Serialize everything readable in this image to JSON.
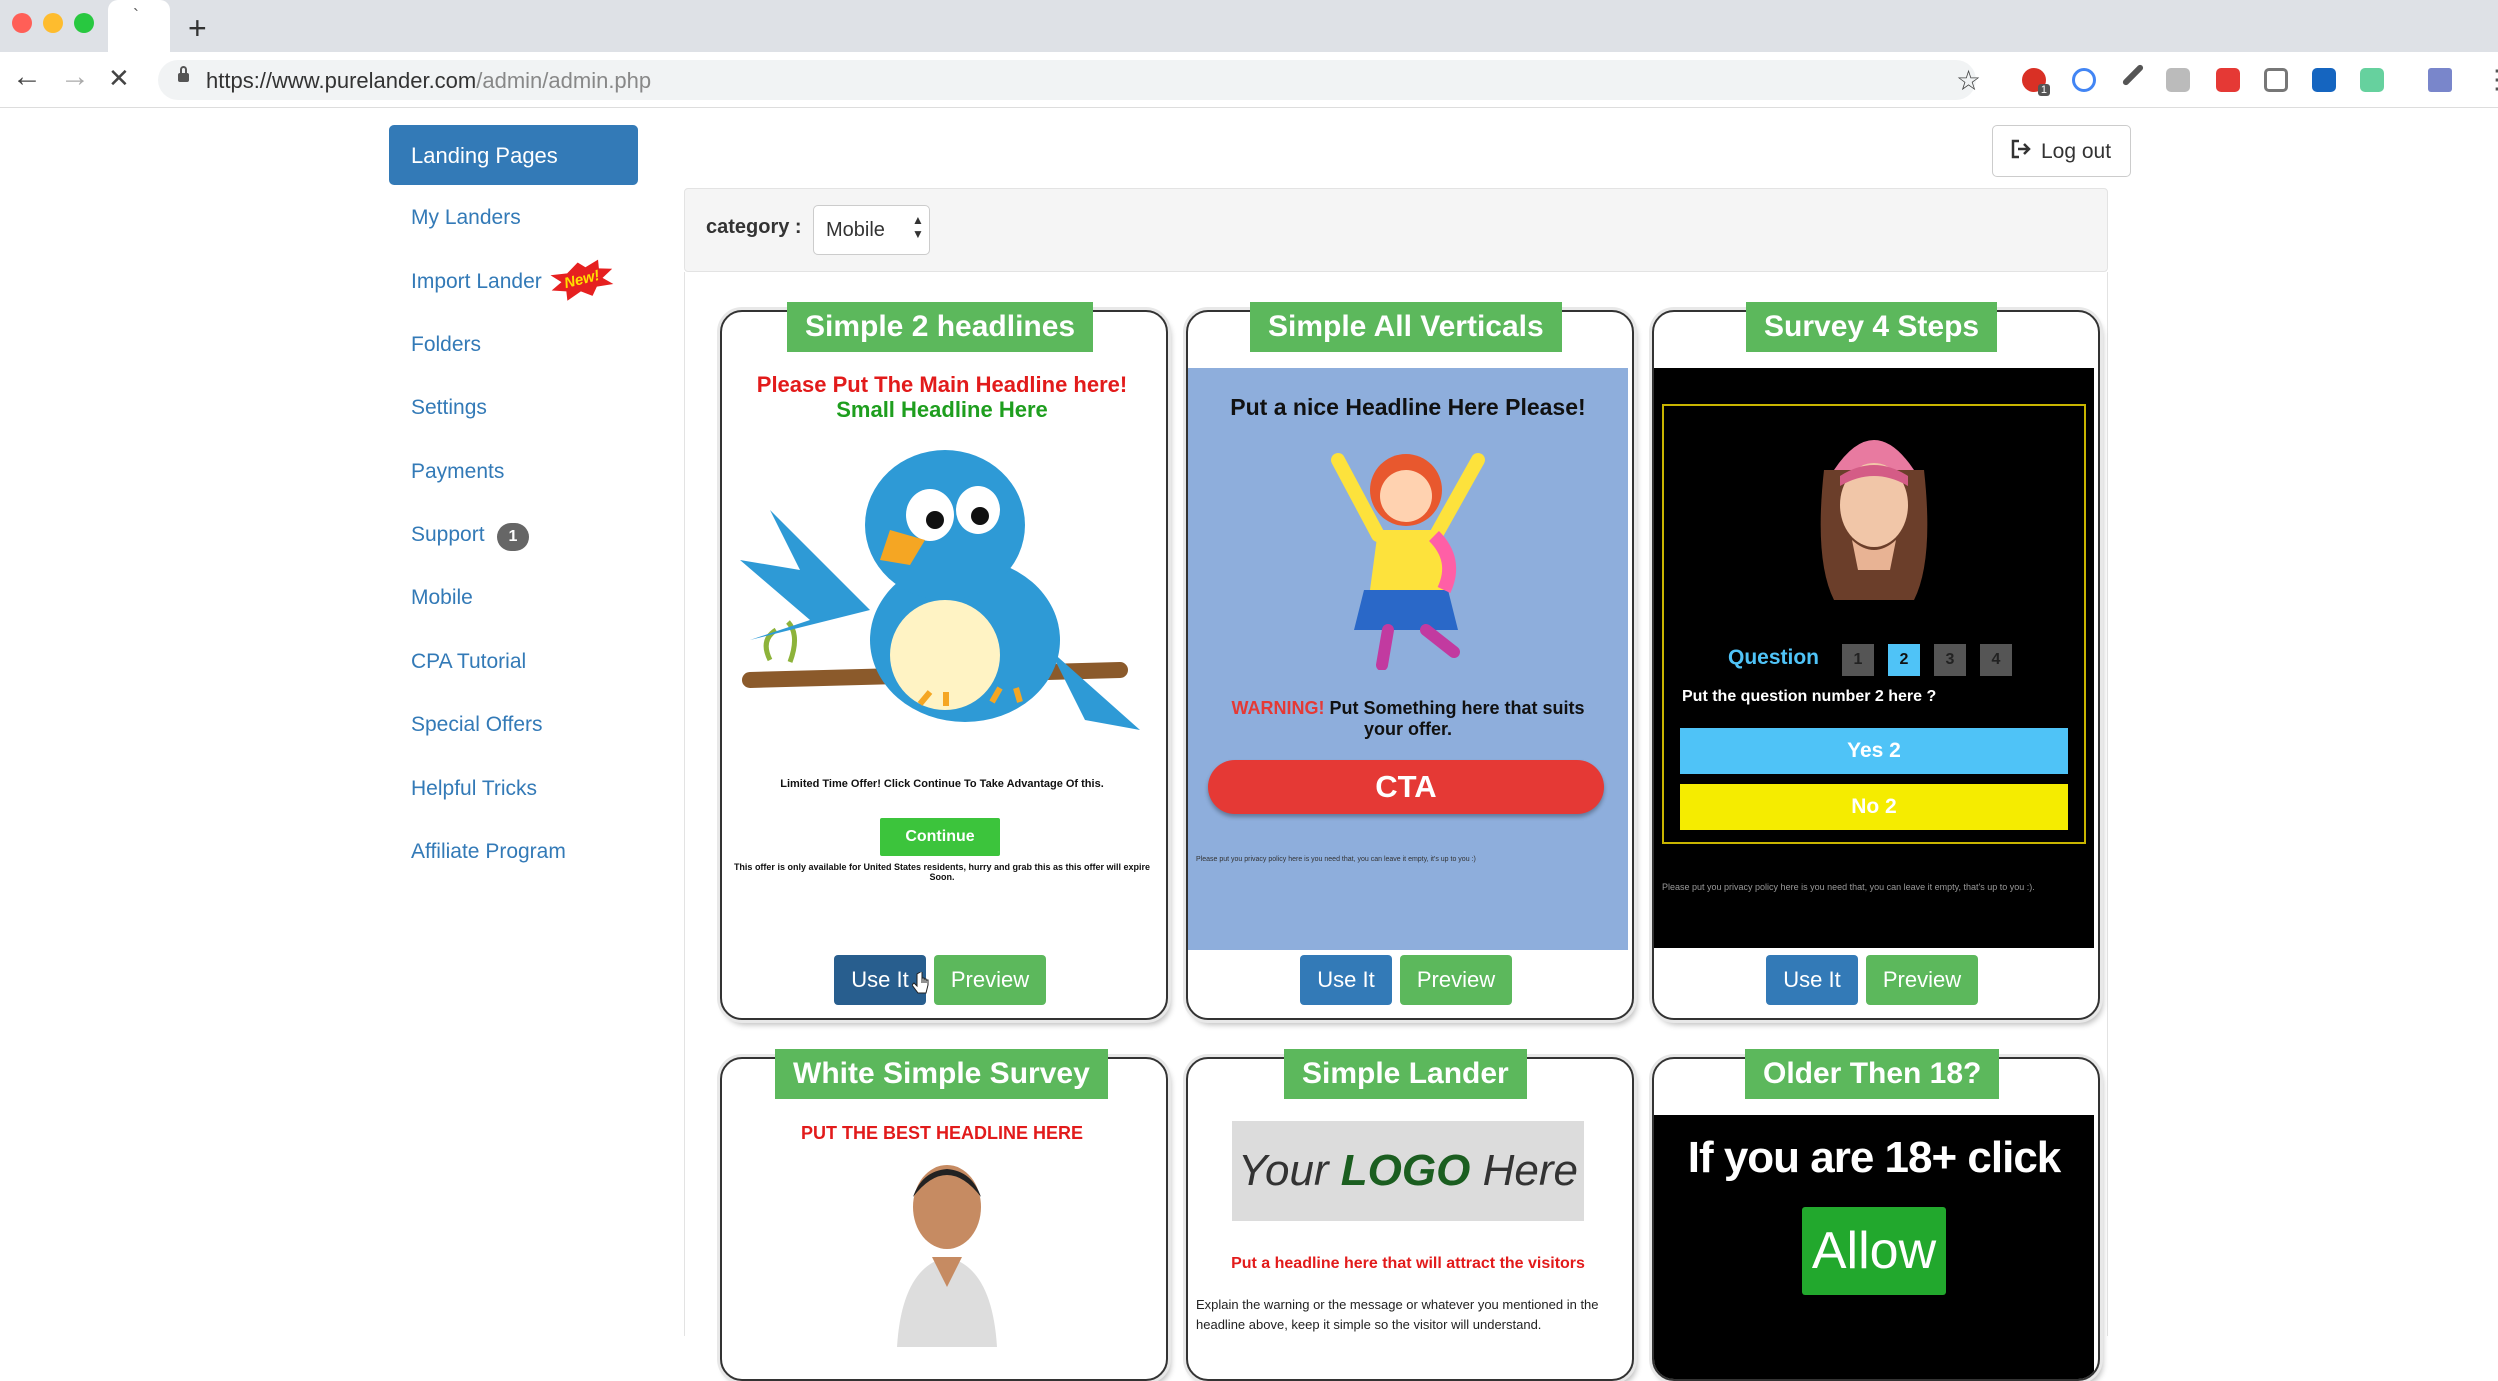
{
  "browser": {
    "tab_title": "`",
    "new_tab": "+",
    "url_host": "https://www.purelander.com",
    "url_path": "/admin/admin.php",
    "nav": {
      "back": "←",
      "forward": "→",
      "reload": "✕"
    },
    "star": "☆",
    "ext_badge": "1"
  },
  "sidebar": {
    "active_label": "Landing Pages",
    "items": [
      {
        "label": "My Landers"
      },
      {
        "label": "Import Lander",
        "badge": "New!"
      },
      {
        "label": "Folders"
      },
      {
        "label": "Settings"
      },
      {
        "label": "Payments"
      },
      {
        "label": "Support",
        "badge": "1"
      },
      {
        "label": "Mobile"
      },
      {
        "label": "CPA Tutorial"
      },
      {
        "label": "Special Offers"
      },
      {
        "label": "Helpful Tricks"
      },
      {
        "label": "Affiliate Program"
      }
    ]
  },
  "header": {
    "logout_label": "Log out"
  },
  "filter": {
    "label": "category :",
    "selected": "Mobile"
  },
  "buttons": {
    "use": "Use It",
    "preview": "Preview"
  },
  "cards": [
    {
      "title": "Simple 2 headlines",
      "headline_main": "Please Put The Main Headline here!",
      "headline_small": "Small Headline Here",
      "offer_text": "Limited Time Offer! Click Continue To Take Advantage Of this.",
      "continue_label": "Continue",
      "disclaimer": "This offer is only available for United States residents, hurry and grab this as this offer will expire Soon."
    },
    {
      "title": "Simple All Verticals",
      "headline": "Put a nice Headline Here Please!",
      "warning_label": "WARNING!",
      "warning_text": "Put Something here that suits your offer.",
      "cta_label": "CTA",
      "policy": "Please put you privacy policy here is you need that, you can leave it empty, it's up to you :)"
    },
    {
      "title": "Survey 4 Steps",
      "question_label": "Question",
      "steps": [
        "1",
        "2",
        "3",
        "4"
      ],
      "question_text": "Put the question number 2 here ?",
      "answer_yes": "Yes 2",
      "answer_no": "No 2",
      "policy": "Please put you privacy policy here is you need that, you can leave it empty, that's up to you :)."
    },
    {
      "title": "White Simple Survey",
      "headline": "PUT THE BEST HEADLINE HERE"
    },
    {
      "title": "Simple Lander",
      "logo_prefix": "Your ",
      "logo_bold": "LOGO",
      "logo_suffix": " Here",
      "headline": "Put a headline here that will attract the visitors",
      "body": "Explain the warning or the message or whatever you mentioned in the headline above, keep it simple so the visitor will understand."
    },
    {
      "title": "Older Then 18?",
      "headline": "If you are 18+ click",
      "allow_label": "Allow"
    }
  ],
  "colors": {
    "primary": "#337ab7",
    "success": "#5cb85c",
    "danger": "#e53935",
    "survey_blue": "#4fc3f7",
    "survey_yellow": "#f5ec00"
  }
}
